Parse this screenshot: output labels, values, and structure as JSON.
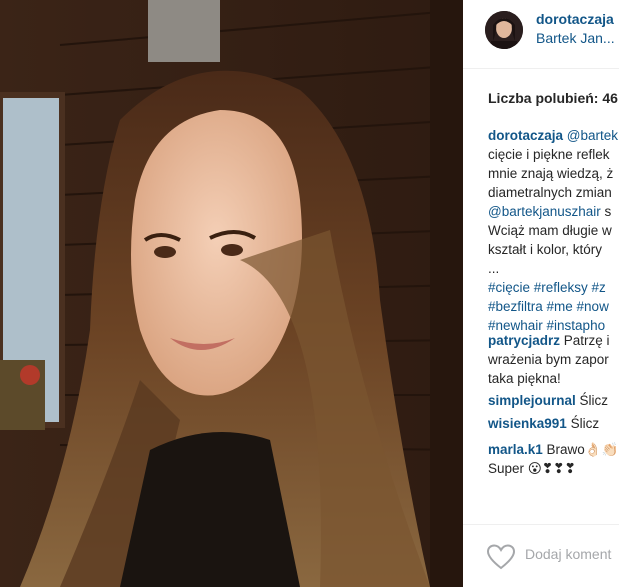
{
  "post": {
    "username": "dorotaczaja",
    "location": "Bartek Jan..."
  },
  "likes_text": "Liczba polubień: 46",
  "caption": {
    "username": "dorotaczaja",
    "mention_1": "@bartek",
    "line_2": "cięcie i piękne reflek",
    "line_3": "mnie znają wiedzą, ż",
    "line_4": "diametralnych zmian",
    "mention_2": "@bartekjanuszhair",
    "mention_2_after": " s",
    "line_6": "Wciąż mam długie w",
    "line_7": "kształt i kolor, który",
    "line_8": "...",
    "hashtags_1": "#cięcie #refleksy #z",
    "hashtags_2": "#bezfiltra #me #now",
    "hashtags_3": "#newhair #instapho"
  },
  "comments": [
    {
      "user": "patrycjadrz",
      "lines": [
        " Patrzę i",
        "wrażenia bym zapor",
        "taka piękna!"
      ]
    },
    {
      "user": "simplejournal",
      "lines": [
        " Ślicz"
      ]
    },
    {
      "user": "wisienka991",
      "lines": [
        " Ślicz"
      ]
    },
    {
      "user": "marla.k1",
      "lines": [
        " Brawo👌🏻👏🏻",
        "Super 😮❣❣❣"
      ]
    }
  ],
  "footer": {
    "add_comment_placeholder": "Dodaj koment"
  },
  "colors": {
    "link": "#125688",
    "text": "#262626",
    "muted": "#a5a7aa"
  },
  "icons": {
    "like": "heart-outline-icon"
  }
}
